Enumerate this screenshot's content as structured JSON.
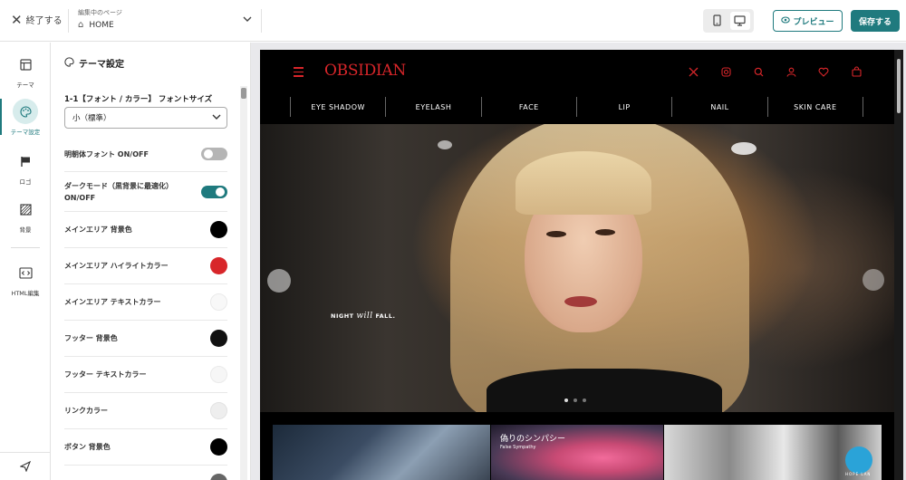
{
  "topbar": {
    "close_label": "終了する",
    "page_caption": "編集中のページ",
    "page_name": "HOME",
    "preview_label": "プレビュー",
    "save_label": "保存する"
  },
  "nav": {
    "items": [
      {
        "label": "テーマ",
        "icon": "layout-icon"
      },
      {
        "label": "テーマ設定",
        "icon": "palette-icon"
      },
      {
        "label": "ロゴ",
        "icon": "flag-icon"
      },
      {
        "label": "背景",
        "icon": "pattern-icon"
      },
      {
        "label": "HTML編集",
        "icon": "code-icon"
      }
    ],
    "bottom_icon": "send-icon"
  },
  "panel": {
    "title": "テーマ設定",
    "font_label": "1-1【フォント / カラー】 フォントサイズ",
    "font_value": "小（標準）",
    "settings": [
      {
        "label": "明朝体フォント ON/OFF",
        "type": "toggle",
        "value": false
      },
      {
        "label": "ダークモード（黒背景に最適化）ON/OFF",
        "type": "toggle",
        "value": true
      },
      {
        "label": "メインエリア 背景色",
        "type": "color",
        "color": "#000000"
      },
      {
        "label": "メインエリア ハイライトカラー",
        "type": "color",
        "color": "#d8262a"
      },
      {
        "label": "メインエリア テキストカラー",
        "type": "color",
        "color": "#f8f8f8"
      },
      {
        "label": "フッター 背景色",
        "type": "color",
        "color": "#111111"
      },
      {
        "label": "フッター テキストカラー",
        "type": "color",
        "color": "#f6f6f6"
      },
      {
        "label": "リンクカラー",
        "type": "color",
        "color": "#eeeeee"
      },
      {
        "label": "ボタン 背景色",
        "type": "color",
        "color": "#000000"
      }
    ]
  },
  "site": {
    "logo": "OBSIDIAN",
    "nav": [
      "EYE SHADOW",
      "EYELASH",
      "FACE",
      "LIP",
      "NAIL",
      "SKIN CARE"
    ],
    "header_icons": [
      "x-icon",
      "instagram-icon",
      "search-icon",
      "user-icon",
      "heart-icon",
      "bag-icon"
    ],
    "hero": {
      "tagline_start": "NIGHT",
      "tagline_script": "will",
      "tagline_end": "FALL.",
      "slide_count": 3,
      "active_slide": 1
    },
    "tiles": [
      {
        "title": "",
        "subtitle": ""
      },
      {
        "title": "偽りのシンパシー",
        "subtitle": "False Sympathy"
      },
      {
        "title": "",
        "subtitle": "HOPE LAN"
      }
    ]
  },
  "colors": {
    "accent": "#1f7a7e",
    "brand_red": "#d8262a"
  }
}
